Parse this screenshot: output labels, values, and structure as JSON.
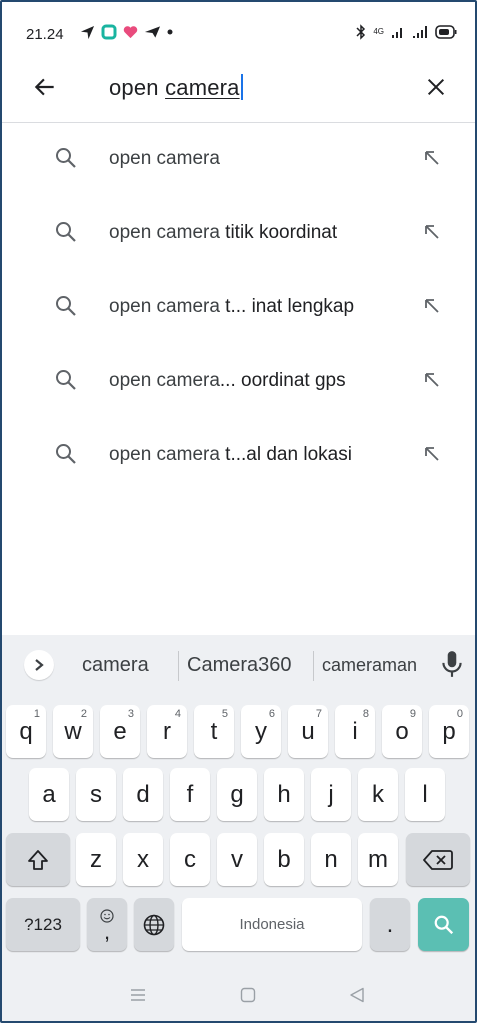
{
  "status_bar": {
    "time": "21.24",
    "icons_left": [
      "navigation-arrow-icon",
      "square-app-icon",
      "heart-app-icon",
      "paper-plane-icon",
      "dot-icon"
    ],
    "icons_right": [
      "bluetooth-icon",
      "4g-signal-icon",
      "signal-bars-icon",
      "battery-icon"
    ],
    "network_label": "4G"
  },
  "search": {
    "query_prefix": "open ",
    "query_underlined": "camera"
  },
  "suggestions": [
    {
      "prefix": "open camera",
      "rest": ""
    },
    {
      "prefix": "open camera",
      "rest": " titik koordinat"
    },
    {
      "prefix": "open camera",
      "rest": " t... inat lengkap"
    },
    {
      "prefix": "open camera",
      "rest": "... oordinat gps"
    },
    {
      "prefix": "open camera",
      "rest": " t...al dan lokasi"
    }
  ],
  "keyboard": {
    "suggestion_strip": [
      "camera",
      "Camera360",
      "cameraman"
    ],
    "row1": [
      {
        "key": "q",
        "hint": "1"
      },
      {
        "key": "w",
        "hint": "2"
      },
      {
        "key": "e",
        "hint": "3"
      },
      {
        "key": "r",
        "hint": "4"
      },
      {
        "key": "t",
        "hint": "5"
      },
      {
        "key": "y",
        "hint": "6"
      },
      {
        "key": "u",
        "hint": "7"
      },
      {
        "key": "i",
        "hint": "8"
      },
      {
        "key": "o",
        "hint": "9"
      },
      {
        "key": "p",
        "hint": "0"
      }
    ],
    "row2": [
      "a",
      "s",
      "d",
      "f",
      "g",
      "h",
      "j",
      "k",
      "l"
    ],
    "row3": [
      "z",
      "x",
      "c",
      "v",
      "b",
      "n",
      "m"
    ],
    "symbols_label": "?123",
    "emoji_comma": ",",
    "space_label": "Indonesia",
    "period": "."
  },
  "colors": {
    "accent": "#5bbfb3",
    "caret": "#1a73e8",
    "keyboard_bg": "#eef0f3"
  }
}
